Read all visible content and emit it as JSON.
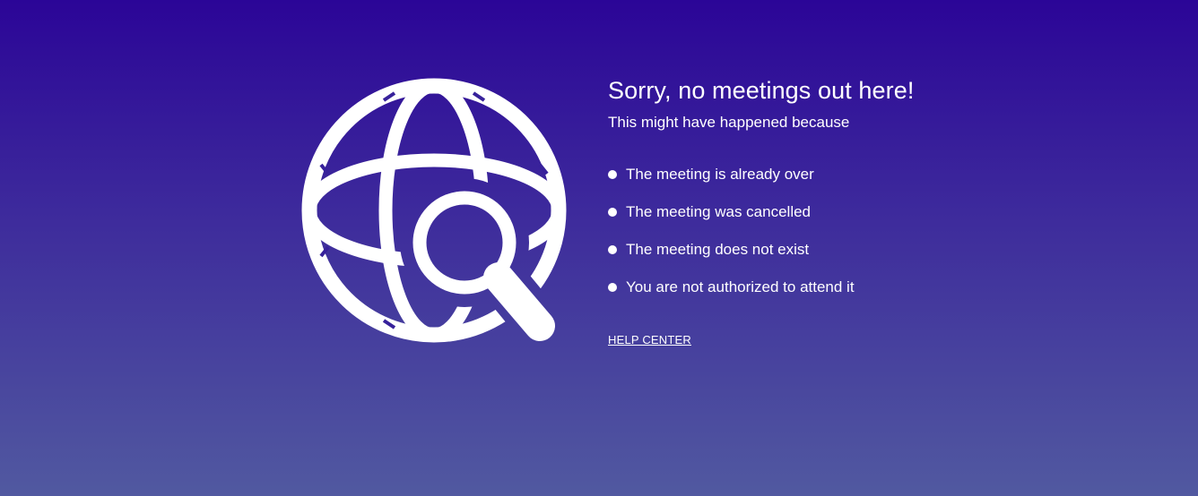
{
  "illustration": {
    "icon": "globe-search-icon",
    "color": "#ffffff"
  },
  "message": {
    "title": "Sorry, no meetings out here!",
    "subtitle": "This might have happened because",
    "reasons": [
      "The meeting is already over",
      "The meeting was cancelled",
      "The meeting does not exist",
      "You are not authorized to attend it"
    ],
    "help_link": "HELP CENTER"
  },
  "colors": {
    "background_top": "#2b0597",
    "background_bottom": "#5159a0",
    "text": "#ffffff"
  }
}
